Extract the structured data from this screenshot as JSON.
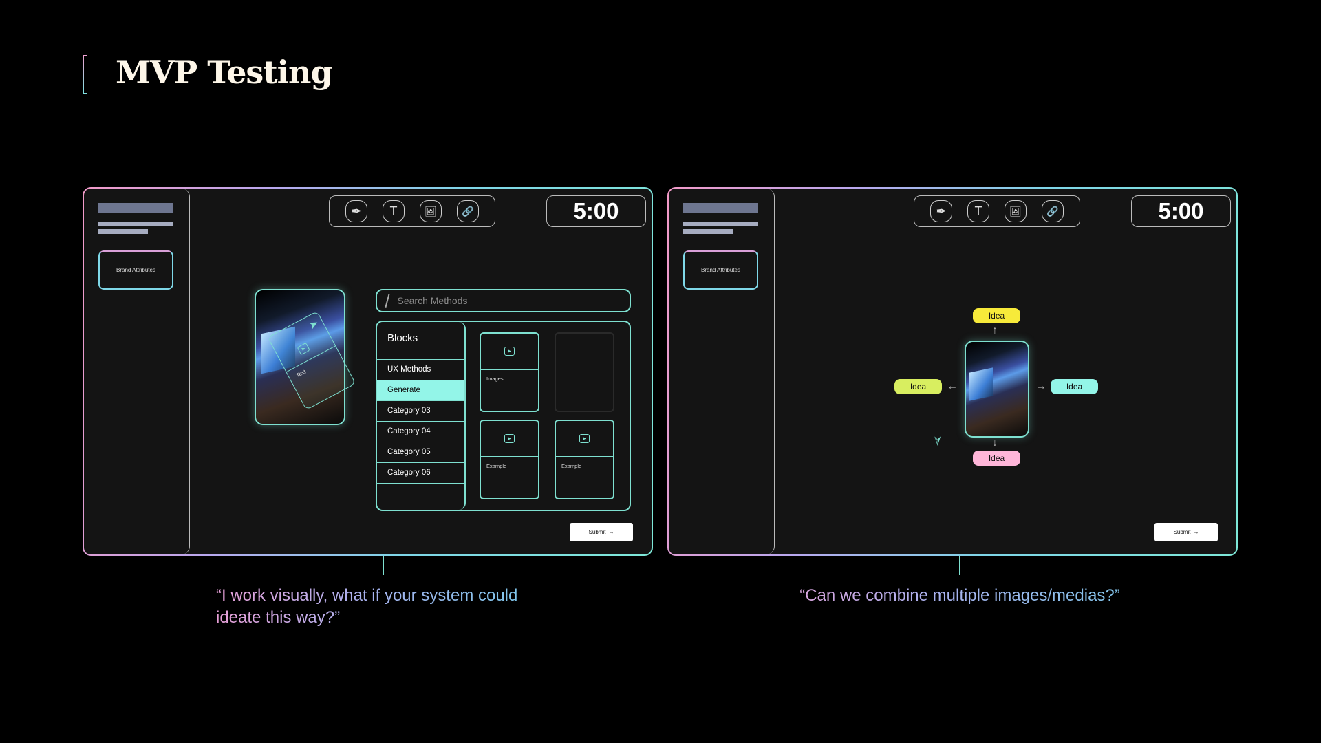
{
  "title": "MVP Testing",
  "colors": {
    "accent": "#7ee0d0",
    "highlight": "#93f5e8",
    "panel_bg": "#141414",
    "idea_yellow": "#f7ea3a",
    "idea_lime": "#d8ee60",
    "idea_cyan": "#93f5e8",
    "idea_pink": "#ffb6d9"
  },
  "left_panel": {
    "sidebar": {
      "brand_label": "Brand Attributes"
    },
    "toolbar": [
      {
        "icon": "pen-icon",
        "glyph": "✒"
      },
      {
        "icon": "text-icon",
        "glyph": "T"
      },
      {
        "icon": "image-icon",
        "glyph": "🖼"
      },
      {
        "icon": "link-icon",
        "glyph": "🔗"
      }
    ],
    "timer": "5:00",
    "photo_card_label": "Text",
    "search_placeholder": "Search Methods",
    "blocks_title": "Blocks",
    "categories": [
      "UX Methods",
      "Generate",
      "Category 03",
      "Category 04",
      "Category 05",
      "Category 06"
    ],
    "active_category": "Generate",
    "cards": [
      "Images",
      "",
      "Example",
      "Example"
    ],
    "submit": "Submit",
    "submit_arrow": "→"
  },
  "right_panel": {
    "sidebar": {
      "brand_label": "Brand Attributes"
    },
    "timer": "5:00",
    "ideas": {
      "top": "Idea",
      "left": "Idea",
      "right": "Idea",
      "bottom": "Idea"
    },
    "submit": "Submit",
    "submit_arrow": "→"
  },
  "quotes": {
    "left": "“I work visually, what if your system could ideate this way?”",
    "right": "“Can we combine multiple images/medias?”"
  }
}
